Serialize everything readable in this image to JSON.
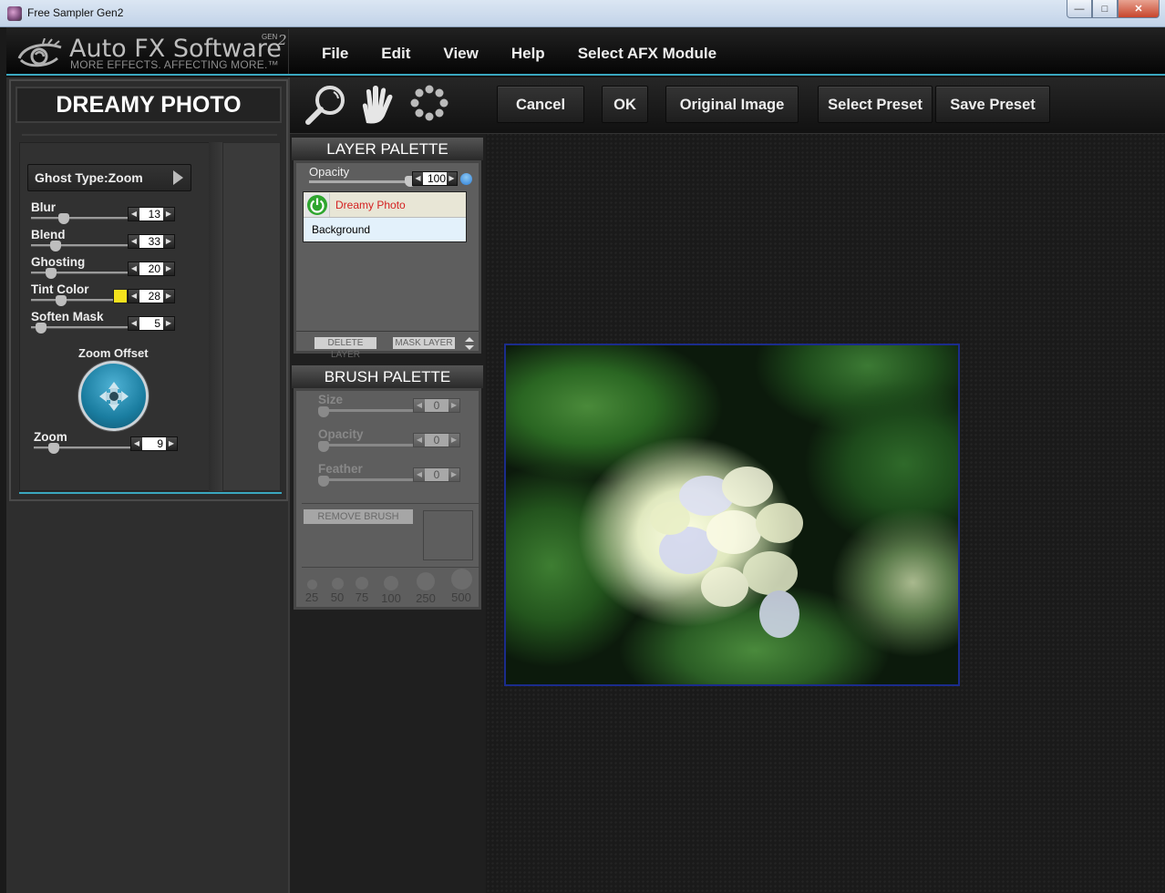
{
  "window": {
    "title": "Free Sampler Gen2",
    "controls": {
      "minimize": "—",
      "maximize": "□",
      "close": "✕"
    }
  },
  "logo": {
    "brand": "Auto FX Software",
    "tagline": "MORE EFFECTS. AFFECTING MORE.™",
    "gen_label": "GEN",
    "gen_number": "2"
  },
  "menu": [
    "File",
    "Edit",
    "View",
    "Help",
    "Select AFX Module"
  ],
  "toolbar": {
    "tools": [
      "zoom-tool",
      "hand-tool",
      "brush-tool"
    ],
    "buttons": {
      "cancel": "Cancel",
      "ok": "OK",
      "original_image": "Original Image",
      "select_preset": "Select Preset",
      "save_preset": "Save Preset"
    }
  },
  "effect_panel": {
    "title": "DREAMY PHOTO",
    "ghost_type": "Ghost Type:Zoom",
    "sliders": [
      {
        "label": "Blur",
        "value": "13",
        "fraction": 0.28
      },
      {
        "label": "Blend",
        "value": "33",
        "fraction": 0.2
      },
      {
        "label": "Ghosting",
        "value": "20",
        "fraction": 0.15
      },
      {
        "label": "Tint Color",
        "value": "28",
        "fraction": 0.3,
        "swatch": "#f4e21d"
      },
      {
        "label": "Soften Mask",
        "value": "5",
        "fraction": 0.05
      }
    ],
    "zoom_offset_label": "Zoom Offset",
    "zoom": {
      "label": "Zoom",
      "value": "9",
      "fraction": 0.15
    }
  },
  "layer_palette": {
    "title": "LAYER PALETTE",
    "opacity_label": "Opacity",
    "opacity_value": "100",
    "layers": [
      {
        "name": "Dreamy Photo",
        "active": true
      },
      {
        "name": "Background",
        "active": false
      }
    ],
    "delete_layer": "DELETE LAYER",
    "mask_layer": "MASK LAYER"
  },
  "brush_palette": {
    "title": "BRUSH PALETTE",
    "sliders": [
      {
        "label": "Size",
        "value": "0"
      },
      {
        "label": "Opacity",
        "value": "0"
      },
      {
        "label": "Feather",
        "value": "0"
      }
    ],
    "remove_brush": "REMOVE BRUSH",
    "sizes": [
      "25",
      "50",
      "75",
      "100",
      "250",
      "500"
    ]
  },
  "colors": {
    "accent_teal": "#3aa7bf",
    "tint_swatch": "#f4e21d",
    "layer_active_text": "#d42020",
    "photo_border": "#1b2c8c"
  }
}
